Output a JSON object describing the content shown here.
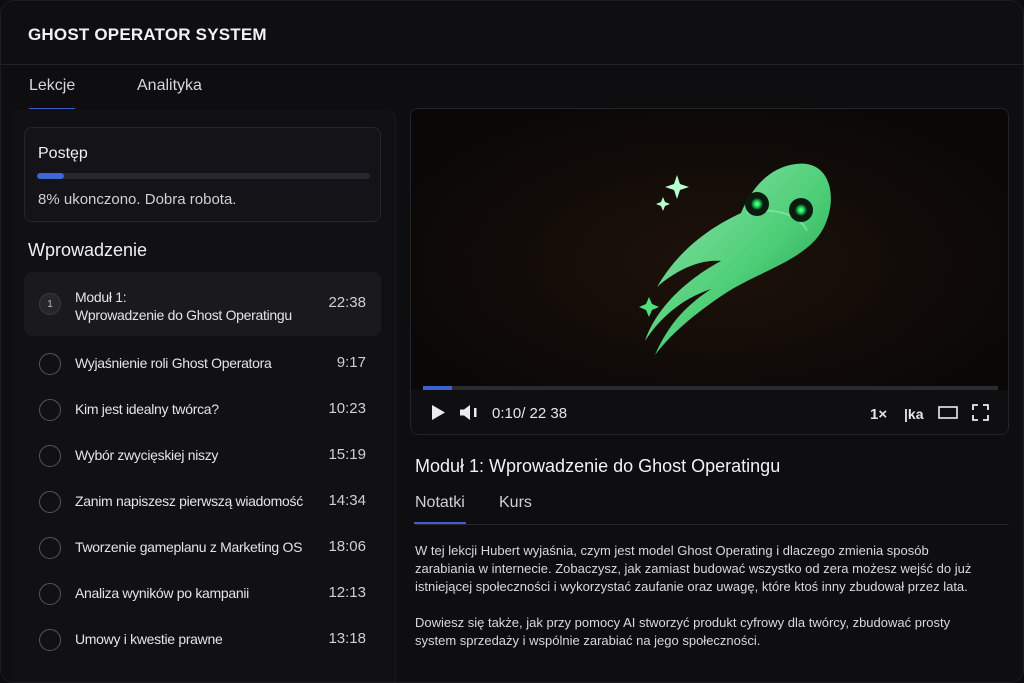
{
  "app": {
    "title": "GHOST OPERATOR SYSTEM"
  },
  "main_tabs": [
    {
      "label": "Lekcje",
      "active": true
    },
    {
      "label": "Analityka",
      "active": false
    }
  ],
  "progress": {
    "title": "Postęp",
    "percent": 8,
    "text": "8% ukonczono. Dobra robota."
  },
  "section": {
    "title": "Wprowadzenie"
  },
  "lessons": [
    {
      "number": "1",
      "title": "Moduł 1:\nWprowadzenie do Ghost Operatingu",
      "duration": "22:38",
      "active": true
    },
    {
      "title": "Wyjaśnienie roli Ghost Operatora",
      "duration": "9:17"
    },
    {
      "title": "Kim jest idealny twórca?",
      "duration": "10:23"
    },
    {
      "title": "Wybór zwycięskiej niszy",
      "duration": "15:19"
    },
    {
      "title": "Zanim napiszesz pierwszą wiadomość",
      "duration": "14:34"
    },
    {
      "title": "Tworzenie gameplanu z Marketing OS",
      "duration": "18:06"
    },
    {
      "title": "Analiza wyników po kampanii",
      "duration": "12:13"
    },
    {
      "title": "Umowy i kwestie prawne",
      "duration": "13:18"
    }
  ],
  "player": {
    "time": "0:10/ 22 38",
    "speed": "1×",
    "captions_label": "|ka",
    "played_fraction": 0.05
  },
  "lesson_detail": {
    "heading": "Moduł 1: Wprowadzenie do Ghost Operatingu",
    "tabs": [
      {
        "label": "Notatki",
        "active": true
      },
      {
        "label": "Kurs",
        "active": false
      }
    ],
    "notes": [
      "W tej lekcji Hubert wyjaśnia, czym jest model Ghost Operating i dlaczego zmienia sposób zarabiania w internecie. Zobaczysz, jak zamiast budować wszystko od zera możesz wejść do już istniejącej społeczności i wykorzystać zaufanie oraz uwagę, które ktoś inny zbudował przez lata.",
      "Dowiesz się także, jak przy pomocy AI stworzyć produkt cyfrowy dla twórcy, zbudować prosty system sprzedaży i wspólnie zarabiać na jego społeczności."
    ]
  },
  "colors": {
    "accent": "#3f67d4",
    "ghost": "#5ee88a",
    "ghost_eye": "#19e05a"
  }
}
